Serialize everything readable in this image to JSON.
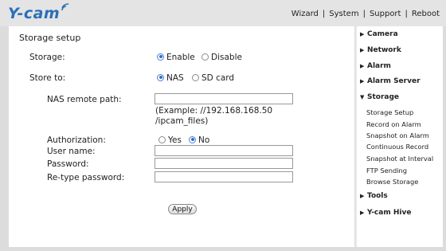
{
  "brand": {
    "logo_text": "Y-cam"
  },
  "topnav": {
    "items": [
      "Wizard",
      "System",
      "Support",
      "Reboot"
    ]
  },
  "form": {
    "title": "Storage setup",
    "storage": {
      "label": "Storage:",
      "options": [
        "Enable",
        "Disable"
      ],
      "selected": "Enable"
    },
    "store_to": {
      "label": "Store to:",
      "options": [
        "NAS",
        "SD card"
      ],
      "selected": "NAS"
    },
    "nas_path": {
      "label": "NAS remote path:",
      "value": "",
      "hint_line1": "(Example: //192.168.168.50",
      "hint_line2": "/ipcam_files)"
    },
    "authorization": {
      "label": "Authorization:",
      "options": [
        "Yes",
        "No"
      ],
      "selected": "No"
    },
    "user_name": {
      "label": "User name:",
      "value": ""
    },
    "password": {
      "label": "Password:",
      "value": ""
    },
    "retype_password": {
      "label": "Re-type password:",
      "value": ""
    },
    "apply_label": "Apply"
  },
  "sidebar": {
    "items": [
      {
        "label": "Camera",
        "expanded": false
      },
      {
        "label": "Network",
        "expanded": false
      },
      {
        "label": "Alarm",
        "expanded": false
      },
      {
        "label": "Alarm Server",
        "expanded": false
      },
      {
        "label": "Storage",
        "expanded": true
      },
      {
        "label": "Tools",
        "expanded": false
      },
      {
        "label": "Y-cam Hive",
        "expanded": false
      }
    ],
    "storage_subitems": [
      "Storage Setup",
      "Record on Alarm",
      "Snapshot on Alarm",
      "Continuous Record",
      "Snapshot at Interval",
      "FTP Sending",
      "Browse Storage"
    ]
  },
  "colors": {
    "logo": "#2b6fb8",
    "radio_selected": "#2f6fc9",
    "background": "#dcdcdc"
  },
  "icons": {
    "collapsed": "triangle-right-icon",
    "expanded": "triangle-down-icon",
    "logo_waves": "wireless-signal-icon"
  }
}
